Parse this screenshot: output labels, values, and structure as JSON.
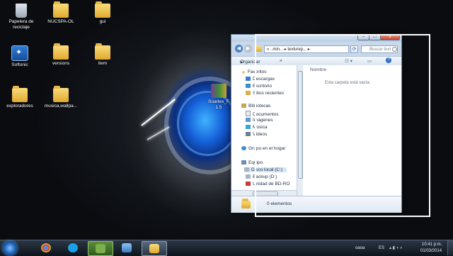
{
  "desktop": {
    "icons": [
      {
        "label_1": "Papelera de",
        "label_2": "reciclaje",
        "icon": "recycle-bin-icon"
      },
      {
        "label_1": "NUCSPA-OL",
        "icon": "folder-icon"
      },
      {
        "label_1": "gui",
        "icon": "folder-icon"
      },
      {
        "label_1": "Softonic",
        "icon": "softonic-icon"
      },
      {
        "label_1": "versions",
        "icon": "folder-icon"
      },
      {
        "label_1": "item",
        "icon": "folder-icon"
      },
      {
        "label_1": "exploradores",
        "icon": "folder-icon"
      },
      {
        "label_1": "musica,wallpa...",
        "icon": "folder-icon"
      }
    ],
    "partial_label_1": "Soartex_F",
    "partial_label_2": "1.5"
  },
  "explorer": {
    "address_parts": [
      "«",
      "..min...",
      "texturep...",
      "▸"
    ],
    "search_placeholder": "Buscar text",
    "organize_label": "Organizar",
    "organize_arrow": "▾",
    "more_label": "»",
    "nav": {
      "favorites_header": "Favoritos",
      "favorites": [
        "Descargas",
        "Escritorio",
        "Sitios recientes"
      ],
      "libraries_header": "Bibliotecas",
      "libraries": [
        "Documentos",
        "Imágenes",
        "Música",
        "Vídeos"
      ],
      "homegroup": "Grupo en el hogar",
      "computer_header": "Equipo",
      "drives": [
        "Disco local (C:)",
        "Backup (D:)",
        "Unidad de BD-RO"
      ]
    },
    "column_header": "Nombre",
    "empty_message": "Esta carpeta está vacía.",
    "status_text": "0 elementos",
    "window_buttons": {
      "minimize": "–",
      "maximize": "□",
      "close": "x"
    }
  },
  "taskbar": {
    "tray_label": "oaoa",
    "language": "ES",
    "time": "10:41 p.m.",
    "date": "01/03/2014"
  },
  "colors": {
    "taskbar": "#0e141c",
    "window_frame": "#c9d9ec",
    "accent_glow": "#1560d8"
  }
}
